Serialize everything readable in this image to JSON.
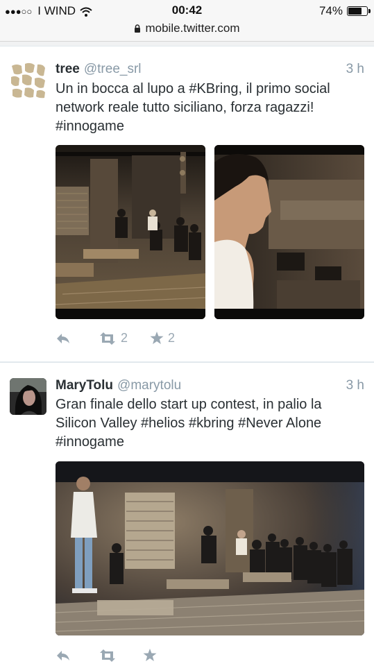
{
  "status_bar": {
    "signal_dots": "●●●○○",
    "carrier": "I WIND",
    "time": "00:42",
    "battery": "74%",
    "battery_level": 0.74
  },
  "browser": {
    "url": "mobile.twitter.com"
  },
  "tweets": [
    {
      "name": "tree",
      "handle": "@tree_srl",
      "time": "3 h",
      "text": "Un in bocca al lupo a #KBring, il primo social network reale tutto siciliano, forza ragazzi! #innogame",
      "retweets": "2",
      "favorites": "2",
      "images": [
        "event-room-photo",
        "speaker-profile-photo"
      ]
    },
    {
      "name": "MaryTolu",
      "handle": "@marytolu",
      "time": "3 h",
      "text": "Gran finale dello start up contest, in palio la Silicon Valley #helios #kbring #Never Alone #innogame",
      "retweets": "",
      "favorites": "",
      "images": [
        "contest-stage-photo"
      ]
    }
  ],
  "icons": {
    "reply": "reply-icon",
    "retweet": "retweet-icon",
    "favorite": "star-icon",
    "lock": "lock-icon",
    "wifi": "wifi-icon"
  },
  "colors": {
    "text": "#292f33",
    "muted": "#8899a6",
    "action_icons": "#9aa8b3",
    "divider": "#e1e8ed"
  }
}
